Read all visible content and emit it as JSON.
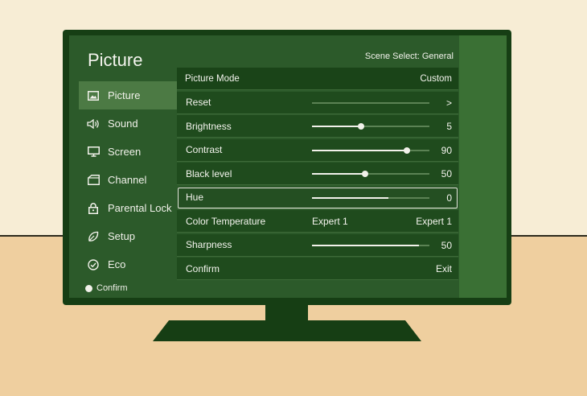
{
  "title": "Picture",
  "scene_select": "Scene Select:  General",
  "sidebar": {
    "items": [
      {
        "label": "Picture",
        "icon": "picture-icon",
        "active": true
      },
      {
        "label": "Sound",
        "icon": "speaker-icon",
        "active": false
      },
      {
        "label": "Screen",
        "icon": "monitor-icon",
        "active": false
      },
      {
        "label": "Channel",
        "icon": "channel-icon",
        "active": false
      },
      {
        "label": "Parental Lock",
        "icon": "lock-icon",
        "active": false
      },
      {
        "label": "Setup",
        "icon": "leaf-icon",
        "active": false
      },
      {
        "label": "Eco",
        "icon": "check-circle-icon",
        "active": false
      }
    ]
  },
  "footer": {
    "label": "Confirm"
  },
  "menu": {
    "header": {
      "label": "Picture Mode",
      "value": "Custom"
    },
    "rows": [
      {
        "label": "Reset",
        "value": ">",
        "type": "slider-empty"
      },
      {
        "label": "Brightness",
        "value": "5",
        "type": "slider",
        "fraction": 0.42
      },
      {
        "label": "Contrast",
        "value": "90",
        "type": "slider",
        "fraction": 0.81
      },
      {
        "label": "Black level",
        "value": "50",
        "type": "slider",
        "fraction": 0.45
      },
      {
        "label": "Hue",
        "value": "0",
        "type": "slider-fill",
        "fraction": 0.65
      },
      {
        "label": "Color Temperature",
        "value": "Expert 1",
        "mid": "Expert 1",
        "type": "text"
      },
      {
        "label": "Sharpness",
        "value": "50",
        "type": "slider-fill",
        "fraction": 0.91
      },
      {
        "label": "Confirm",
        "value": "Exit",
        "type": "text"
      }
    ]
  }
}
